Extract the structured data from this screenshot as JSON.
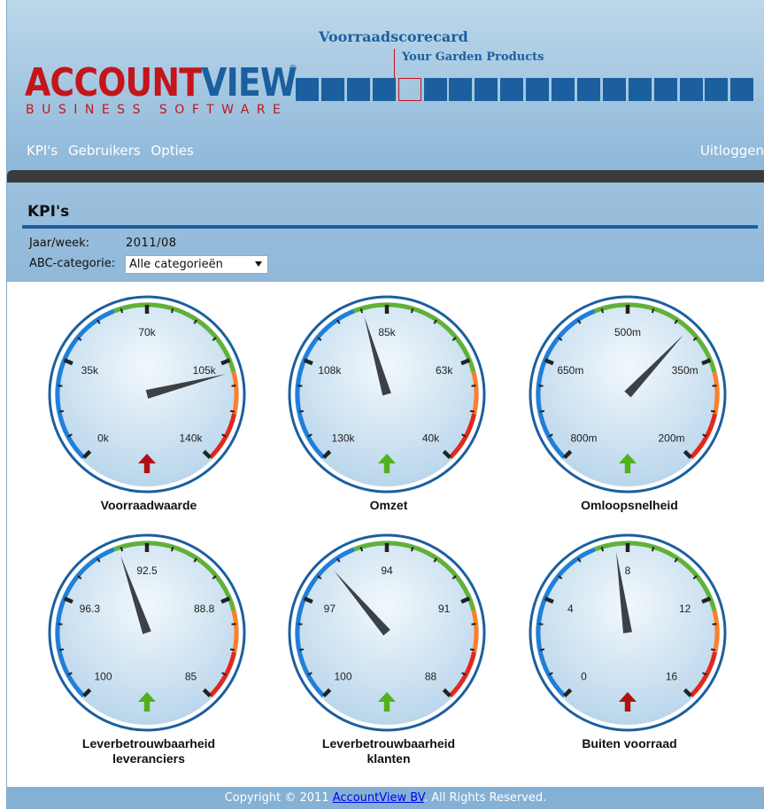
{
  "header": {
    "logo": {
      "part1": "ACCOUNT",
      "part2": "VIEW",
      "reg": "®",
      "subtitle": "BUSINESS SOFTWARE"
    },
    "app_title": "Voorraadscorecard",
    "company": "Your Garden Products",
    "week_squares": {
      "count": 18,
      "active_index": 4
    }
  },
  "nav": {
    "items": [
      "KPI's",
      "Gebruikers",
      "Opties"
    ],
    "logout": "Uitloggen"
  },
  "kpi_panel": {
    "title": "KPI's",
    "year_week_label": "Jaar/week:",
    "year_week_value": "2011/08",
    "abc_label": "ABC-categorie:",
    "abc_selected": "Alle categorieën"
  },
  "gauges": [
    {
      "label_lines": [
        "Voorraadwaarde"
      ],
      "ticks": [
        "0k",
        "35k",
        "70k",
        "105k",
        "140k"
      ],
      "value": 0.78,
      "arrow": "up",
      "arrow_color": "#b01212",
      "arc_colors": [
        "#1f7fd9",
        "#5fb236",
        "#ff7f27",
        "#e8251b"
      ]
    },
    {
      "label_lines": [
        "Omzet"
      ],
      "ticks": [
        "130k",
        "108k",
        "85k",
        "63k",
        "40k"
      ],
      "value": 0.44,
      "arrow": "up",
      "arrow_color": "#4fb21b",
      "arc_colors": [
        "#1f7fd9",
        "#5fb236",
        "#ff7f27",
        "#e8251b"
      ]
    },
    {
      "label_lines": [
        "Omloopsnelheid"
      ],
      "ticks": [
        "800m",
        "650m",
        "500m",
        "350m",
        "200m"
      ],
      "value": 0.66,
      "arrow": "up",
      "arrow_color": "#4fb21b",
      "arc_colors": [
        "#1f7fd9",
        "#5fb236",
        "#ff7f27",
        "#e8251b"
      ]
    },
    {
      "label_lines": [
        "Leverbetrouwbaarheid",
        "leveranciers"
      ],
      "ticks": [
        "100",
        "96.3",
        "92.5",
        "88.8",
        "85"
      ],
      "value": 0.43,
      "arrow": "up",
      "arrow_color": "#4fb21b",
      "arc_colors": [
        "#1f7fd9",
        "#5fb236",
        "#ff7f27",
        "#e8251b"
      ]
    },
    {
      "label_lines": [
        "Leverbetrouwbaarheid",
        "klanten"
      ],
      "ticks": [
        "100",
        "97",
        "94",
        "91",
        "88"
      ],
      "value": 0.35,
      "arrow": "up",
      "arrow_color": "#4fb21b",
      "arc_colors": [
        "#1f7fd9",
        "#5fb236",
        "#ff7f27",
        "#e8251b"
      ]
    },
    {
      "label_lines": [
        "Buiten voorraad"
      ],
      "ticks": [
        "0",
        "4",
        "8",
        "12",
        "16"
      ],
      "value": 0.47,
      "arrow": "up",
      "arrow_color": "#b01212",
      "arc_colors": [
        "#1f7fd9",
        "#5fb236",
        "#ff7f27",
        "#e8251b"
      ]
    }
  ],
  "footer": {
    "prefix": "Copyright © 2011 ",
    "link": "AccountView BV",
    "suffix": ". All Rights Reserved."
  }
}
